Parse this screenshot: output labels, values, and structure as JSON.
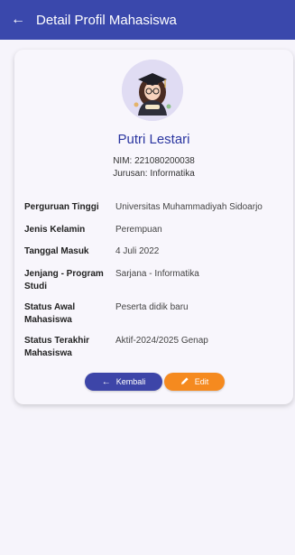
{
  "appbar": {
    "title": "Detail Profil Mahasiswa"
  },
  "profile": {
    "name": "Putri Lestari",
    "nim": "NIM: 221080200038",
    "jurusan": "Jurusan: Informatika"
  },
  "details": [
    {
      "label": "Perguruan Tinggi",
      "value": "Universitas Muhammadiyah Sidoarjo"
    },
    {
      "label": "Jenis Kelamin",
      "value": "Perempuan"
    },
    {
      "label": "Tanggal Masuk",
      "value": "4 Juli 2022"
    },
    {
      "label": "Jenjang - Program Studi",
      "value": "Sarjana - Informatika"
    },
    {
      "label": "Status Awal Mahasiswa",
      "value": "Peserta didik baru"
    },
    {
      "label": "Status Terakhir Mahasiswa",
      "value": "Aktif-2024/2025 Genap"
    }
  ],
  "actions": {
    "back_label": "Kembali",
    "edit_label": "Edit"
  },
  "colors": {
    "primary": "#3a48ac",
    "accent": "#f58a1f",
    "background": "#f6f4fb"
  }
}
